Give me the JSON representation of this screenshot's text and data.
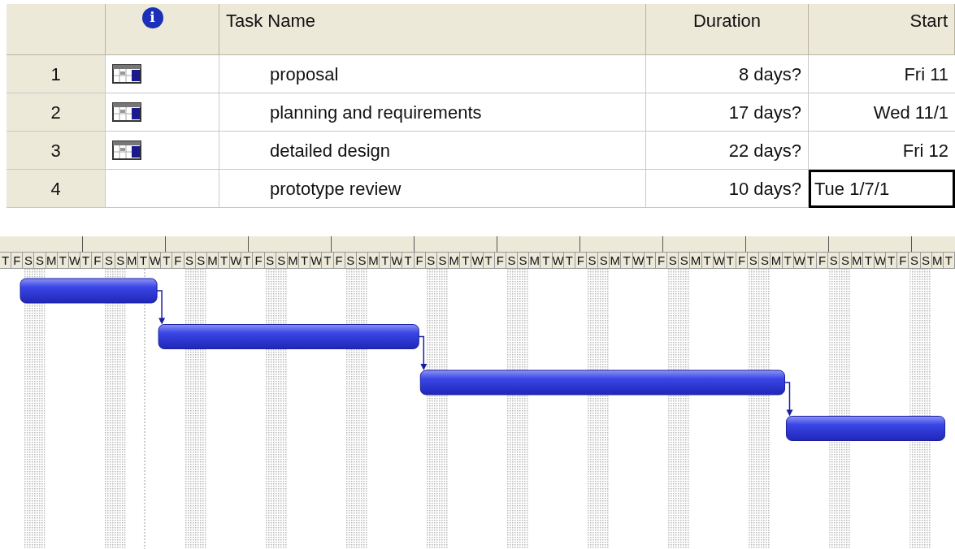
{
  "table": {
    "columns": [
      {
        "kind": "id"
      },
      {
        "kind": "indicator",
        "label": "i"
      },
      {
        "kind": "name",
        "label": "Task Name"
      },
      {
        "kind": "duration",
        "label": "Duration"
      },
      {
        "kind": "start",
        "label": "Start"
      }
    ],
    "rows": [
      {
        "id": "1",
        "has_indicator": true,
        "name": "proposal",
        "duration": "8 days?",
        "start": "Fri 11",
        "start_selected": false
      },
      {
        "id": "2",
        "has_indicator": true,
        "name": "planning and requirements",
        "duration": "17 days?",
        "start": "Wed 11/1",
        "start_selected": false
      },
      {
        "id": "3",
        "has_indicator": true,
        "name": "detailed design",
        "duration": "22 days?",
        "start": "Fri 12",
        "start_selected": false
      },
      {
        "id": "4",
        "has_indicator": false,
        "name": "prototype review",
        "duration": "10 days?",
        "start": "Tue 1/7/1",
        "start_selected": true
      }
    ]
  },
  "timescale": {
    "days": [
      "T",
      "F",
      "S",
      "S",
      "M",
      "T",
      "W",
      "T",
      "F",
      "S",
      "S",
      "M",
      "T",
      "W",
      "T",
      "F",
      "S",
      "S",
      "M",
      "T",
      "W",
      "T",
      "F",
      "S",
      "S",
      "M",
      "T",
      "W",
      "T",
      "F",
      "S",
      "S",
      "M",
      "T",
      "W",
      "T",
      "F",
      "S",
      "S",
      "M",
      "T",
      "W",
      "T",
      "F",
      "S",
      "S",
      "M",
      "T",
      "W",
      "T",
      "F",
      "S",
      "S",
      "M",
      "T",
      "W",
      "T",
      "F",
      "S",
      "S",
      "M",
      "T",
      "W",
      "T",
      "F",
      "S",
      "S",
      "M",
      "T",
      "W",
      "T",
      "F",
      "S",
      "S",
      "M",
      "T",
      "W",
      "T",
      "F",
      "S",
      "S",
      "M",
      "T"
    ]
  }
}
